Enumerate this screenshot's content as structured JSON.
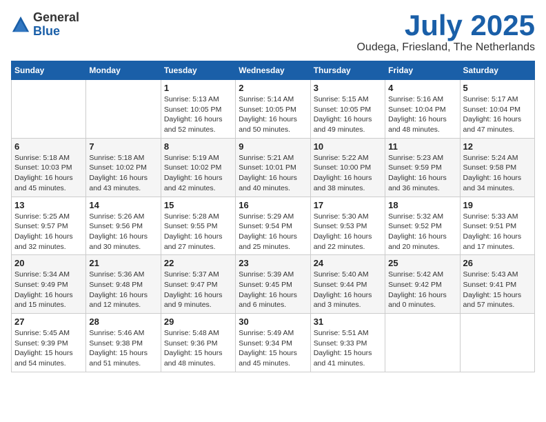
{
  "header": {
    "logo_general": "General",
    "logo_blue": "Blue",
    "month_title": "July 2025",
    "location": "Oudega, Friesland, The Netherlands"
  },
  "days_of_week": [
    "Sunday",
    "Monday",
    "Tuesday",
    "Wednesday",
    "Thursday",
    "Friday",
    "Saturday"
  ],
  "weeks": [
    [
      {
        "day": "",
        "info": ""
      },
      {
        "day": "",
        "info": ""
      },
      {
        "day": "1",
        "info": "Sunrise: 5:13 AM\nSunset: 10:05 PM\nDaylight: 16 hours\nand 52 minutes."
      },
      {
        "day": "2",
        "info": "Sunrise: 5:14 AM\nSunset: 10:05 PM\nDaylight: 16 hours\nand 50 minutes."
      },
      {
        "day": "3",
        "info": "Sunrise: 5:15 AM\nSunset: 10:05 PM\nDaylight: 16 hours\nand 49 minutes."
      },
      {
        "day": "4",
        "info": "Sunrise: 5:16 AM\nSunset: 10:04 PM\nDaylight: 16 hours\nand 48 minutes."
      },
      {
        "day": "5",
        "info": "Sunrise: 5:17 AM\nSunset: 10:04 PM\nDaylight: 16 hours\nand 47 minutes."
      }
    ],
    [
      {
        "day": "6",
        "info": "Sunrise: 5:18 AM\nSunset: 10:03 PM\nDaylight: 16 hours\nand 45 minutes."
      },
      {
        "day": "7",
        "info": "Sunrise: 5:18 AM\nSunset: 10:02 PM\nDaylight: 16 hours\nand 43 minutes."
      },
      {
        "day": "8",
        "info": "Sunrise: 5:19 AM\nSunset: 10:02 PM\nDaylight: 16 hours\nand 42 minutes."
      },
      {
        "day": "9",
        "info": "Sunrise: 5:21 AM\nSunset: 10:01 PM\nDaylight: 16 hours\nand 40 minutes."
      },
      {
        "day": "10",
        "info": "Sunrise: 5:22 AM\nSunset: 10:00 PM\nDaylight: 16 hours\nand 38 minutes."
      },
      {
        "day": "11",
        "info": "Sunrise: 5:23 AM\nSunset: 9:59 PM\nDaylight: 16 hours\nand 36 minutes."
      },
      {
        "day": "12",
        "info": "Sunrise: 5:24 AM\nSunset: 9:58 PM\nDaylight: 16 hours\nand 34 minutes."
      }
    ],
    [
      {
        "day": "13",
        "info": "Sunrise: 5:25 AM\nSunset: 9:57 PM\nDaylight: 16 hours\nand 32 minutes."
      },
      {
        "day": "14",
        "info": "Sunrise: 5:26 AM\nSunset: 9:56 PM\nDaylight: 16 hours\nand 30 minutes."
      },
      {
        "day": "15",
        "info": "Sunrise: 5:28 AM\nSunset: 9:55 PM\nDaylight: 16 hours\nand 27 minutes."
      },
      {
        "day": "16",
        "info": "Sunrise: 5:29 AM\nSunset: 9:54 PM\nDaylight: 16 hours\nand 25 minutes."
      },
      {
        "day": "17",
        "info": "Sunrise: 5:30 AM\nSunset: 9:53 PM\nDaylight: 16 hours\nand 22 minutes."
      },
      {
        "day": "18",
        "info": "Sunrise: 5:32 AM\nSunset: 9:52 PM\nDaylight: 16 hours\nand 20 minutes."
      },
      {
        "day": "19",
        "info": "Sunrise: 5:33 AM\nSunset: 9:51 PM\nDaylight: 16 hours\nand 17 minutes."
      }
    ],
    [
      {
        "day": "20",
        "info": "Sunrise: 5:34 AM\nSunset: 9:49 PM\nDaylight: 16 hours\nand 15 minutes."
      },
      {
        "day": "21",
        "info": "Sunrise: 5:36 AM\nSunset: 9:48 PM\nDaylight: 16 hours\nand 12 minutes."
      },
      {
        "day": "22",
        "info": "Sunrise: 5:37 AM\nSunset: 9:47 PM\nDaylight: 16 hours\nand 9 minutes."
      },
      {
        "day": "23",
        "info": "Sunrise: 5:39 AM\nSunset: 9:45 PM\nDaylight: 16 hours\nand 6 minutes."
      },
      {
        "day": "24",
        "info": "Sunrise: 5:40 AM\nSunset: 9:44 PM\nDaylight: 16 hours\nand 3 minutes."
      },
      {
        "day": "25",
        "info": "Sunrise: 5:42 AM\nSunset: 9:42 PM\nDaylight: 16 hours\nand 0 minutes."
      },
      {
        "day": "26",
        "info": "Sunrise: 5:43 AM\nSunset: 9:41 PM\nDaylight: 15 hours\nand 57 minutes."
      }
    ],
    [
      {
        "day": "27",
        "info": "Sunrise: 5:45 AM\nSunset: 9:39 PM\nDaylight: 15 hours\nand 54 minutes."
      },
      {
        "day": "28",
        "info": "Sunrise: 5:46 AM\nSunset: 9:38 PM\nDaylight: 15 hours\nand 51 minutes."
      },
      {
        "day": "29",
        "info": "Sunrise: 5:48 AM\nSunset: 9:36 PM\nDaylight: 15 hours\nand 48 minutes."
      },
      {
        "day": "30",
        "info": "Sunrise: 5:49 AM\nSunset: 9:34 PM\nDaylight: 15 hours\nand 45 minutes."
      },
      {
        "day": "31",
        "info": "Sunrise: 5:51 AM\nSunset: 9:33 PM\nDaylight: 15 hours\nand 41 minutes."
      },
      {
        "day": "",
        "info": ""
      },
      {
        "day": "",
        "info": ""
      }
    ]
  ]
}
